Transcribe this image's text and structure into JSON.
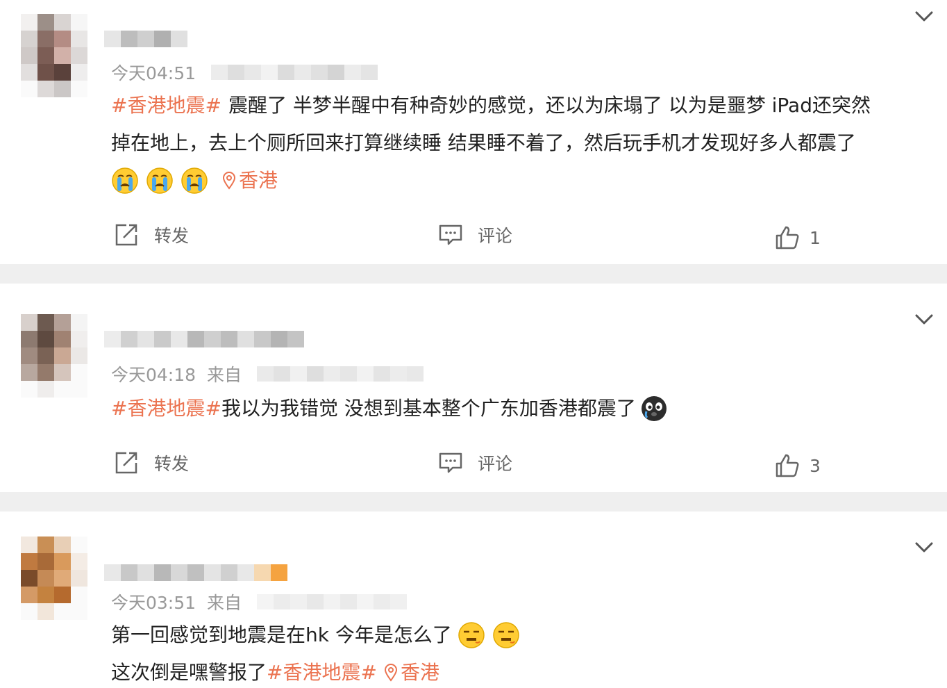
{
  "posts": [
    {
      "time": "今天04:51",
      "tag": "#香港地震#",
      "line1": "震醒了 半梦半醒中有种奇妙的感觉，还以为床塌了 以为是噩梦 iPad还突然",
      "line2": "掉在地上，去上个厕所回来打算继续睡 结果睡不着了，然后玩手机才发现好多人都震了",
      "emojis": [
        "crying-emoji",
        "crying-emoji",
        "crying-emoji"
      ],
      "location": "香港",
      "repost_label": "转发",
      "comment_label": "评论",
      "like_count": "1"
    },
    {
      "time": "今天04:18",
      "source_label": "来自",
      "tag": "#香港地震#",
      "line1": "我以为我错觉 没想到基本整个广东加香港都震了",
      "emojis": [
        "tearful-dog-emoji"
      ],
      "repost_label": "转发",
      "comment_label": "评论",
      "like_count": "3"
    },
    {
      "time": "今天03:51",
      "source_label": "来自",
      "line1": "第一回感觉到地震是在hk 今年是怎么了",
      "emojis": [
        "speechless-emoji",
        "speechless-emoji"
      ],
      "line2_prefix": "这次倒是嘿警报了",
      "tag": "#香港地震#",
      "location": "香港"
    }
  ],
  "icons": {
    "chevron": "chevron-down-icon",
    "repost": "repost-icon",
    "comment": "comment-icon",
    "like": "thumbs-up-icon",
    "location": "location-pin-icon"
  },
  "colors": {
    "tag": "#eb7350",
    "meta": "#999999",
    "action": "#666666",
    "divider": "#efefef"
  }
}
